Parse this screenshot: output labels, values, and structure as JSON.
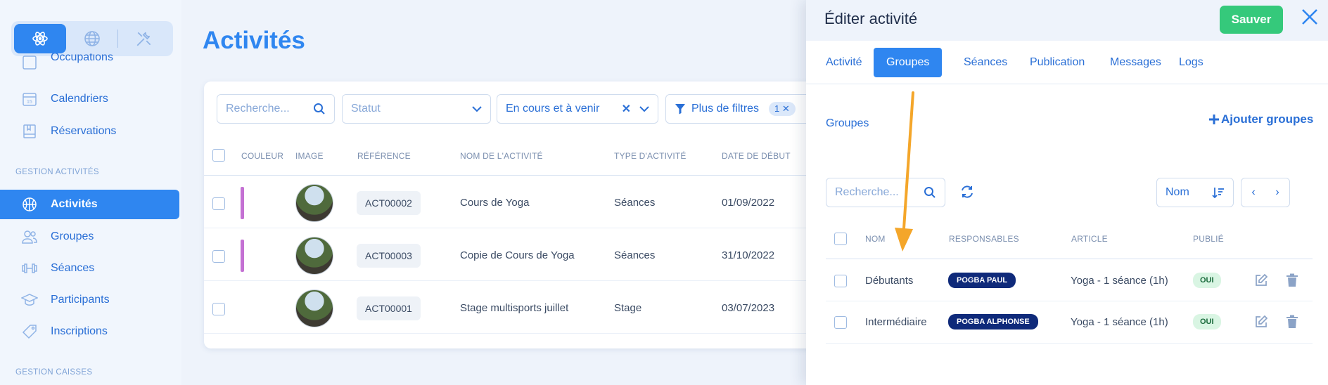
{
  "sidebar": {
    "modes": [
      {
        "icon": "atom-icon",
        "active": true
      },
      {
        "icon": "globe-icon",
        "active": false
      },
      {
        "icon": "tools-icon",
        "active": false
      }
    ],
    "items_top": [
      {
        "label": "Occupations",
        "icon": "occupations-icon"
      },
      {
        "label": "Calendriers",
        "icon": "calendar-icon"
      },
      {
        "label": "Réservations",
        "icon": "book-icon"
      }
    ],
    "section_activities": "GESTION ACTIVITÉS",
    "items_activities": [
      {
        "label": "Activités",
        "icon": "basketball-icon",
        "active": true
      },
      {
        "label": "Groupes",
        "icon": "users-icon"
      },
      {
        "label": "Séances",
        "icon": "dumbbell-icon"
      },
      {
        "label": "Participants",
        "icon": "graduation-cap-icon"
      },
      {
        "label": "Inscriptions",
        "icon": "tag-icon"
      }
    ],
    "section_cash": "GESTION CAISSES"
  },
  "main": {
    "title": "Activités",
    "filters": {
      "search_placeholder": "Recherche...",
      "status_placeholder": "Statut",
      "period_value": "En cours et à venir",
      "more_filters_label": "Plus de filtres",
      "more_filters_count": "1"
    },
    "table": {
      "headers": [
        "COULEUR",
        "IMAGE",
        "RÉFÉRENCE",
        "NOM DE L'ACTIVITÉ",
        "TYPE D'ACTIVITÉ",
        "DATE DE DÉBUT"
      ],
      "rows": [
        {
          "color": "#c471d3",
          "reference": "ACT00002",
          "name": "Cours de Yoga",
          "type": "Séances",
          "start_date": "01/09/2022"
        },
        {
          "color": "#c471d3",
          "reference": "ACT00003",
          "name": "Copie de Cours de Yoga",
          "type": "Séances",
          "start_date": "31/10/2022"
        },
        {
          "color": null,
          "reference": "ACT00001",
          "name": "Stage multisports juillet",
          "type": "Stage",
          "start_date": "03/07/2023"
        }
      ]
    }
  },
  "panel": {
    "title": "Éditer activité",
    "save_label": "Sauver",
    "tabs": [
      "Activité",
      "Groupes",
      "Séances",
      "Publication",
      "Messages",
      "Logs"
    ],
    "active_tab": "Groupes",
    "section_label": "Groupes",
    "add_groups_label": "Ajouter groupes",
    "search_placeholder": "Recherche...",
    "sort_value": "Nom",
    "table": {
      "headers": [
        "NOM",
        "RESPONSABLES",
        "ARTICLE",
        "PUBLIÉ"
      ],
      "rows": [
        {
          "name": "Débutants",
          "responsable": "POGBA PAUL",
          "article": "Yoga - 1 séance (1h)",
          "published": "OUI"
        },
        {
          "name": "Intermédiaire",
          "responsable": "POGBA ALPHONSE",
          "article": "Yoga - 1 séance (1h)",
          "published": "OUI"
        }
      ]
    }
  },
  "colors": {
    "accent": "#2f86f0",
    "save": "#35c97b",
    "badge": "#0f2a7a",
    "annotation_arrow": "#f4a62a"
  }
}
